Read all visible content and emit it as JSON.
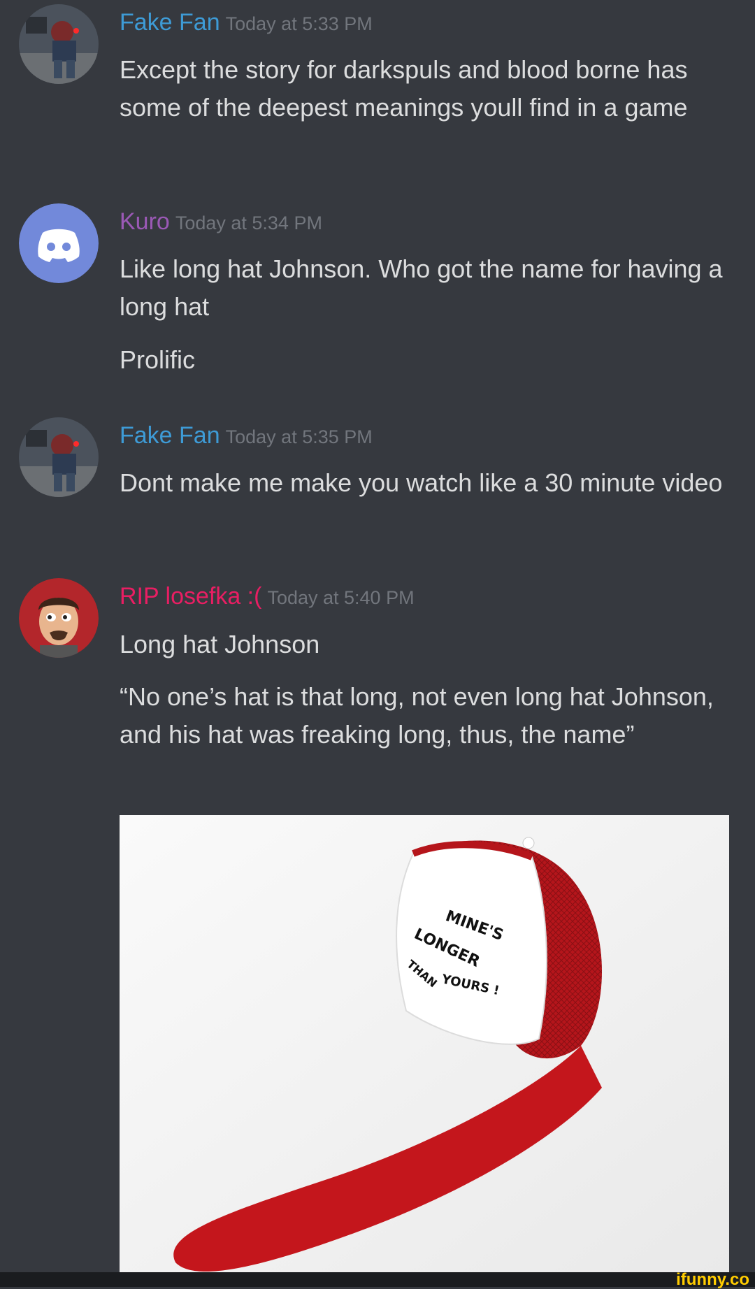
{
  "messages": [
    {
      "author": "Fake Fan",
      "author_color": "#3e9bd6",
      "time": "Today at 5:33 PM",
      "lines": [
        "Except the story for darkspuls and blood borne has some of the deepest meanings youll find in a game"
      ]
    },
    {
      "author": "Kuro",
      "author_color": "#9b59b6",
      "time": "Today at 5:34 PM",
      "lines": [
        "Like long hat Johnson. Who got the name for having a long hat",
        "Prolific"
      ]
    },
    {
      "author": "Fake Fan",
      "author_color": "#3e9bd6",
      "time": "Today at 5:35 PM",
      "lines": [
        "Dont make me make you watch like a 30 minute video"
      ]
    },
    {
      "author": "RIP losefka :(",
      "author_color": "#e91e63",
      "time": "Today at 5:40 PM",
      "lines": [
        "Long hat Johnson",
        "“No one’s hat is that long, not even long hat Johnson, and his hat was freaking long, thus, the name”"
      ]
    }
  ],
  "image_caption_text": [
    "MINE'S",
    "LONGER",
    "THAN",
    "YOURS !"
  ],
  "watermark": "ifunny.co",
  "colors": {
    "background": "#36393f",
    "text": "#dcddde",
    "timestamp": "#72767d",
    "discord_blurple": "#7289da",
    "cap_red": "#c4161c"
  }
}
